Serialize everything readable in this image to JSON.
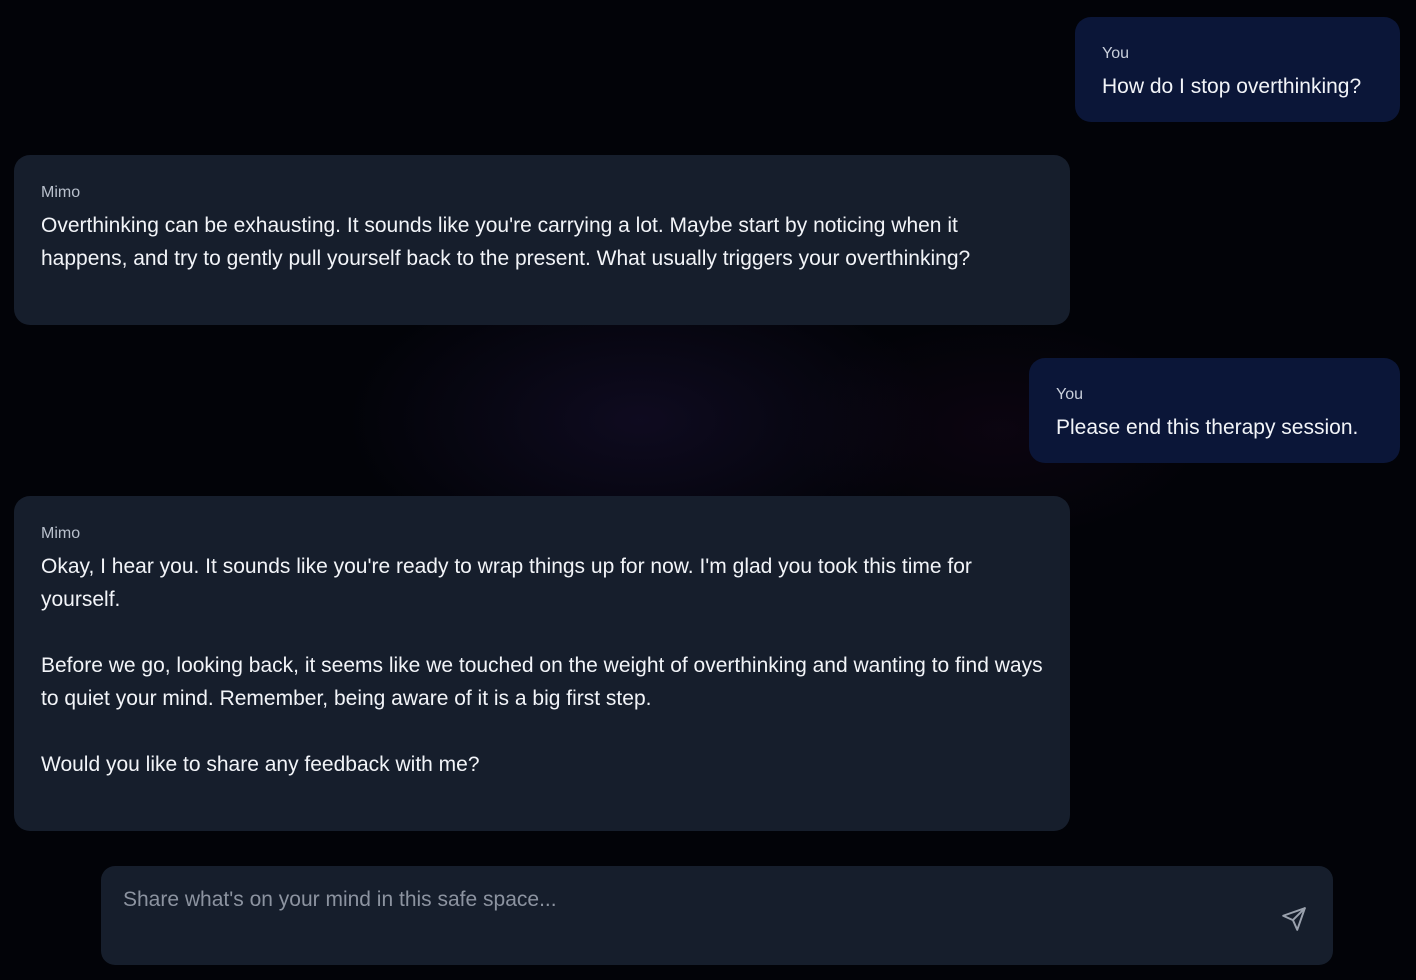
{
  "conversation": {
    "messages": [
      {
        "role": "user",
        "sender": "You",
        "text": "How do I stop overthinking?"
      },
      {
        "role": "assistant",
        "sender": "Mimo",
        "paragraphs": [
          "Overthinking can be exhausting. It sounds like you're carrying a lot. Maybe start by noticing when it happens, and try to gently pull yourself back to the present. What usually triggers your overthinking?"
        ]
      },
      {
        "role": "user",
        "sender": "You",
        "text": "Please end this therapy session."
      },
      {
        "role": "assistant",
        "sender": "Mimo",
        "paragraphs": [
          "Okay, I hear you. It sounds like you're ready to wrap things up for now. I'm glad you took this time for yourself.",
          "Before we go, looking back, it seems like we touched on the weight of overthinking and wanting to find ways to quiet your mind. Remember, being aware of it is a big first step.",
          "Would you like to share any feedback with me?"
        ]
      }
    ]
  },
  "composer": {
    "value": "",
    "placeholder": "Share what's on your mind in this safe space...",
    "send_icon": "send-icon"
  },
  "colors": {
    "page_background": "#020308",
    "user_bubble": "#0b1638",
    "assistant_bubble": "#161e2c",
    "text": "#f2f4f8",
    "placeholder": "#8c93a0"
  }
}
